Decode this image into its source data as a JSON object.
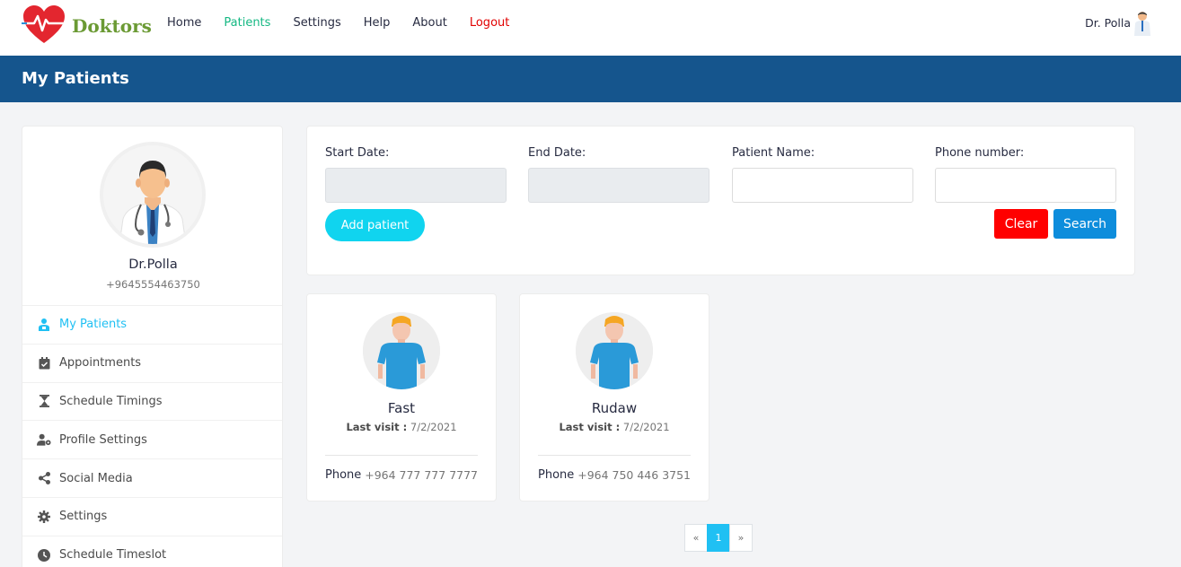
{
  "header": {
    "logo_text": "Doktors",
    "nav": [
      "Home",
      "Patients",
      "Settings",
      "Help",
      "About",
      "Logout"
    ],
    "active_nav": "Patients",
    "user_name": "Dr. Polla"
  },
  "page_title": "My Patients",
  "profile": {
    "name": "Dr.Polla",
    "phone": "+9645554463750"
  },
  "menu": [
    {
      "label": "My Patients",
      "icon": "patient-icon",
      "active": true
    },
    {
      "label": "Appointments",
      "icon": "calendar-check-icon",
      "active": false
    },
    {
      "label": "Schedule Timings",
      "icon": "hourglass-icon",
      "active": false
    },
    {
      "label": "Profile Settings",
      "icon": "user-cog-icon",
      "active": false
    },
    {
      "label": "Social Media",
      "icon": "share-icon",
      "active": false
    },
    {
      "label": "Settings",
      "icon": "gear-icon",
      "active": false
    },
    {
      "label": "Schedule Timeslot",
      "icon": "clock-icon",
      "active": false
    }
  ],
  "search": {
    "start_date_label": "Start Date:",
    "end_date_label": "End Date:",
    "patient_name_label": "Patient Name:",
    "phone_label": "Phone number:",
    "start_date_value": "",
    "end_date_value": "",
    "patient_name_value": "",
    "phone_value": "",
    "add_patient_label": "Add patient",
    "clear_label": "Clear",
    "search_label": "Search"
  },
  "patients": [
    {
      "name": "Fast",
      "last_visit_label": "Last visit :",
      "last_visit": "7/2/2021",
      "phone_label": "Phone",
      "phone": "+964 777 777 7777"
    },
    {
      "name": "Rudaw",
      "last_visit_label": "Last visit :",
      "last_visit": "7/2/2021",
      "phone_label": "Phone",
      "phone": "+964 750 446 3751"
    }
  ],
  "pagination": {
    "prev": "«",
    "pages": [
      "1"
    ],
    "current": "1",
    "next": "»"
  },
  "colors": {
    "header_bar": "#15558d",
    "accent": "#20c0f3",
    "nav_active": "#15b883",
    "logout": "#e10000",
    "clear_button": "#ff0000",
    "search_button": "#0d8ddc",
    "add_button": "#10d4ef"
  }
}
